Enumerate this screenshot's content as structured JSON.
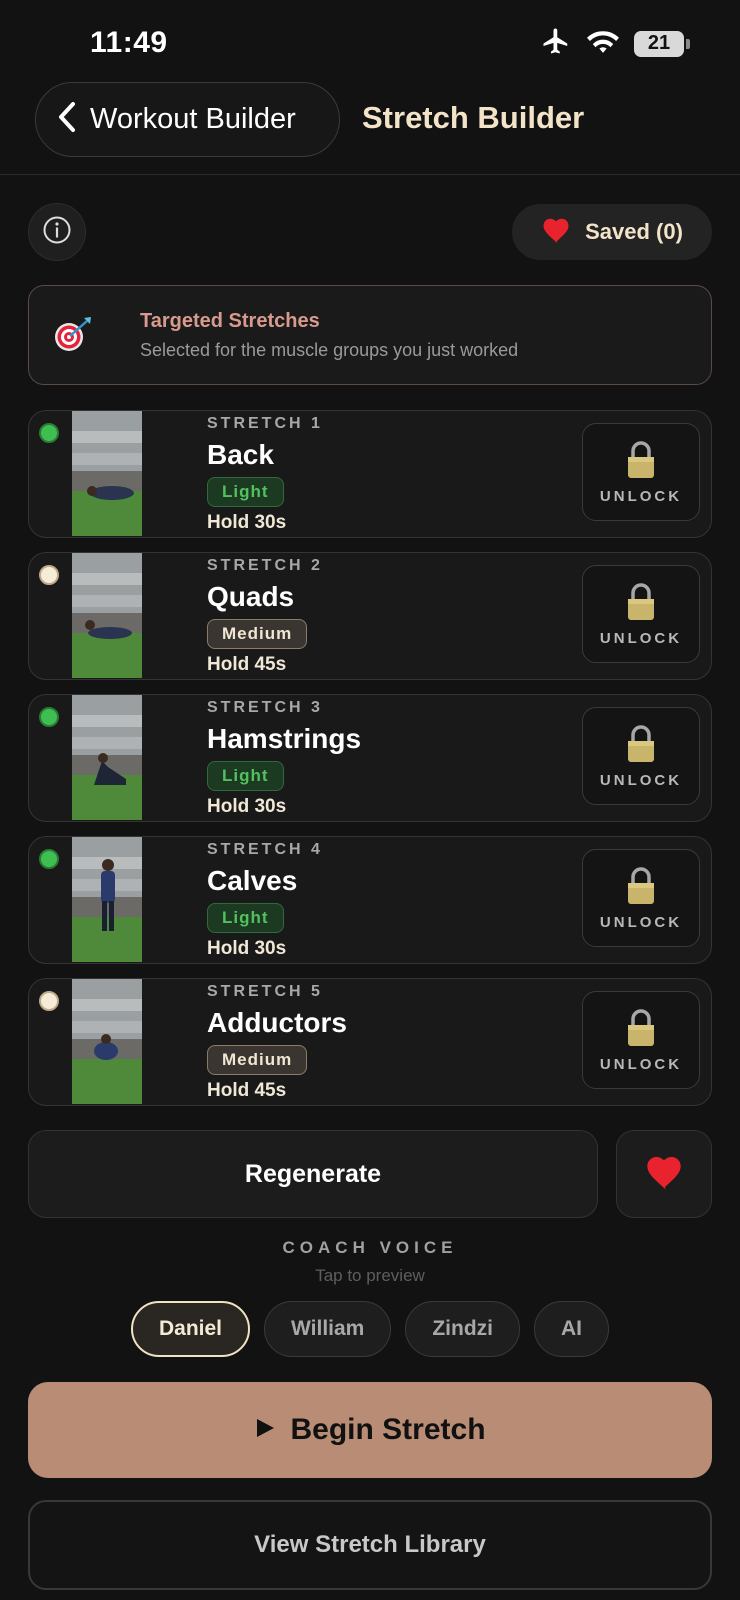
{
  "status_bar": {
    "time": "11:49",
    "battery": "21"
  },
  "nav": {
    "back_label": "Workout Builder",
    "title": "Stretch Builder"
  },
  "controls": {
    "saved_label": "Saved (0)"
  },
  "banner": {
    "title": "Targeted Stretches",
    "subtitle": "Selected for the muscle groups you just worked"
  },
  "stretches": [
    {
      "label": "STRETCH 1",
      "name": "Back",
      "intensity": "Light",
      "hold": "Hold 30s",
      "unlock_label": "UNLOCK",
      "dot": "green"
    },
    {
      "label": "STRETCH 2",
      "name": "Quads",
      "intensity": "Medium",
      "hold": "Hold 45s",
      "unlock_label": "UNLOCK",
      "dot": "cream"
    },
    {
      "label": "STRETCH 3",
      "name": "Hamstrings",
      "intensity": "Light",
      "hold": "Hold 30s",
      "unlock_label": "UNLOCK",
      "dot": "green"
    },
    {
      "label": "STRETCH 4",
      "name": "Calves",
      "intensity": "Light",
      "hold": "Hold 30s",
      "unlock_label": "UNLOCK",
      "dot": "green"
    },
    {
      "label": "STRETCH 5",
      "name": "Adductors",
      "intensity": "Medium",
      "hold": "Hold 45s",
      "unlock_label": "UNLOCK",
      "dot": "cream"
    }
  ],
  "actions": {
    "regenerate_label": "Regenerate"
  },
  "coach_voice": {
    "title": "COACH VOICE",
    "subtitle": "Tap to preview",
    "voices": [
      "Daniel",
      "William",
      "Zindzi",
      "AI"
    ],
    "selected": "Daniel"
  },
  "begin_label": "Begin Stretch",
  "library_label": "View Stretch Library",
  "colors": {
    "background": "#121212",
    "accent": "#b88c75",
    "title_cream": "#f3e3c8",
    "light_green": "#53c05f",
    "banner_title": "#d99a8e"
  }
}
